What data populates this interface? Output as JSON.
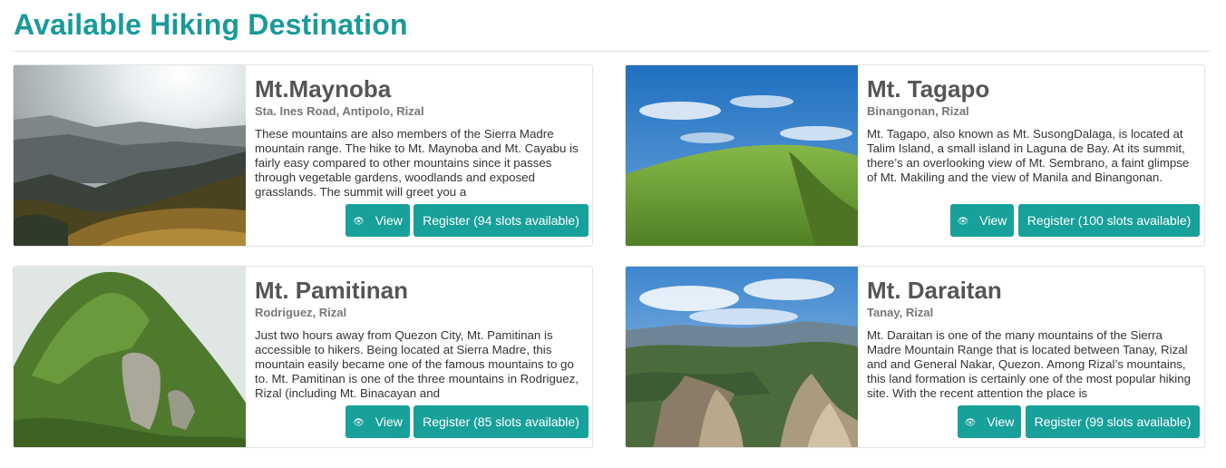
{
  "page": {
    "title": "Available Hiking Destination"
  },
  "destinations": [
    {
      "name": "Mt.Maynoba",
      "location": "Sta. Ines Road, Antipolo, Rizal",
      "description": "These mountains are also members of the Sierra Madre mountain range. The hike to Mt. Maynoba and Mt. Cayabu is fairly easy compared to other mountains since it passes through vegetable gardens, woodlands and exposed grasslands. The summit will greet you a",
      "view_label": "View",
      "register_label": "Register (94 slots available)"
    },
    {
      "name": "Mt. Tagapo",
      "location": "Binangonan, Rizal",
      "description": "Mt. Tagapo, also known as Mt. SusongDalaga, is located at Talim Island, a small island in Laguna de Bay. At its summit, there’s an overlooking view of Mt. Sembrano, a faint glimpse of Mt. Makiling and the view of Manila and Binangonan.",
      "view_label": "View",
      "register_label": "Register (100 slots available)"
    },
    {
      "name": "Mt. Pamitinan",
      "location": "Rodriguez, Rizal",
      "description": "Just two hours away from Quezon City, Mt. Pamitinan is accessible to hikers. Being located at Sierra Madre, this mountain easily became one of the famous mountains to go to. Mt. Pamitinan is one of the three mountains in Rodriguez, Rizal (including Mt. Binacayan and",
      "view_label": "View",
      "register_label": "Register (85 slots available)"
    },
    {
      "name": "Mt. Daraitan",
      "location": "Tanay, Rizal",
      "description": "Mt. Daraitan is one of the many mountains of the Sierra Madre Mountain Range that is located between Tanay, Rizal and and General Nakar, Quezon. Among Rizal’s mountains, this land formation is certainly one of the most popular hiking site. With the recent attention the place is",
      "view_label": "View",
      "register_label": "Register (99 slots available)"
    }
  ],
  "icons": {
    "view_button": "eye-icon"
  },
  "colors": {
    "accent": "#1a9a9a",
    "button": "#18a09a"
  }
}
